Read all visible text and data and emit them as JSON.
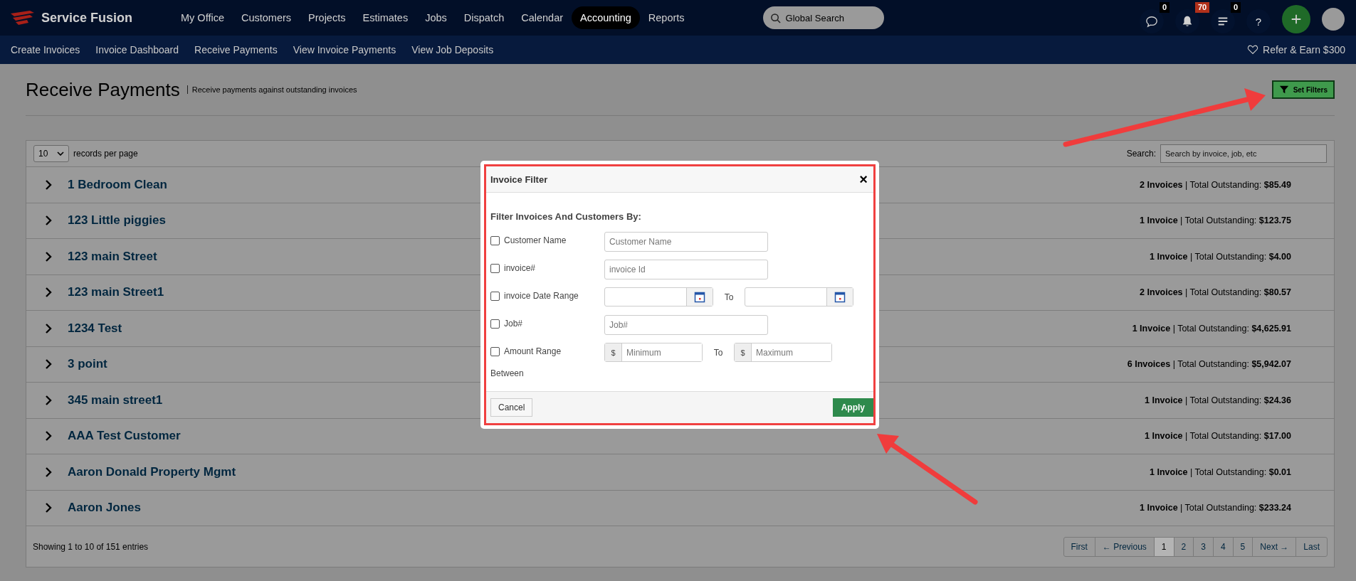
{
  "brand": {
    "name": "Service Fusion"
  },
  "nav": [
    {
      "label": "My Office",
      "selected": false
    },
    {
      "label": "Customers",
      "selected": false
    },
    {
      "label": "Projects",
      "selected": false
    },
    {
      "label": "Estimates",
      "selected": false
    },
    {
      "label": "Jobs",
      "selected": false
    },
    {
      "label": "Dispatch",
      "selected": false
    },
    {
      "label": "Calendar",
      "selected": false
    },
    {
      "label": "Accounting",
      "selected": true
    },
    {
      "label": "Reports",
      "selected": false
    }
  ],
  "global_search": {
    "placeholder": "Global Search"
  },
  "header_icons": [
    {
      "kind": "chat",
      "badge": "0",
      "alert": false
    },
    {
      "kind": "bell",
      "badge": "70",
      "alert": true
    },
    {
      "kind": "list",
      "badge": "0",
      "alert": false
    },
    {
      "kind": "help",
      "text": "?"
    },
    {
      "kind": "add"
    },
    {
      "kind": "avatar"
    }
  ],
  "subnav": [
    "Create Invoices",
    "Invoice Dashboard",
    "Receive Payments",
    "View Invoice Payments",
    "View Job Deposits"
  ],
  "refer": "Refer & Earn $300",
  "page": {
    "title": "Receive Payments",
    "subtitle": "Receive payments against outstanding invoices",
    "filter_button": "Set Filters"
  },
  "table": {
    "page_size": "10",
    "page_size_label": "records per page",
    "search_label": "Search:",
    "search_placeholder": "Search by invoice, job, etc",
    "rows": [
      {
        "name": "1 Bedroom Clean",
        "summary": "**2 Invoices** | Total Outstanding: **$85.49**"
      },
      {
        "name": "123 Little piggies",
        "summary": "**1 Invoice** | Total Outstanding: **$123.75**"
      },
      {
        "name": "123 main Street",
        "summary": "**1 Invoice** | Total Outstanding: **$4.00**"
      },
      {
        "name": "123 main Street1",
        "summary": "**2 Invoices** | Total Outstanding: **$80.57**"
      },
      {
        "name": "1234 Test",
        "summary": "**1 Invoice** | Total Outstanding: **$4,625.91**"
      },
      {
        "name": "3 point",
        "summary": "**6 Invoices** | Total Outstanding: **$5,942.07**"
      },
      {
        "name": "345 main street1",
        "summary": "**1 Invoice** | Total Outstanding: **$24.36**"
      },
      {
        "name": "AAA Test Customer",
        "summary": "**1 Invoice** | Total Outstanding: **$17.00**"
      },
      {
        "name": "Aaron Donald Property Mgmt",
        "summary": "**1 Invoice** | Total Outstanding: **$0.01**"
      },
      {
        "name": "Aaron Jones",
        "summary": "**1 Invoice** | Total Outstanding: **$233.24**"
      }
    ],
    "info": "Showing 1 to 10 of 151 entries",
    "pagination": [
      {
        "label": "First",
        "selected": false
      },
      {
        "label": "← Previous",
        "selected": false
      },
      {
        "label": "1",
        "selected": true
      },
      {
        "label": "2",
        "selected": false
      },
      {
        "label": "3",
        "selected": false
      },
      {
        "label": "4",
        "selected": false
      },
      {
        "label": "5",
        "selected": false
      },
      {
        "label": "Next →",
        "selected": false
      },
      {
        "label": "Last",
        "selected": false
      }
    ]
  },
  "dialog": {
    "title": "Invoice Filter",
    "close": "×",
    "heading": "Filter Invoices And Customers By:",
    "filters": [
      {
        "kind": "text",
        "label": "Customer Name",
        "checked": false,
        "placeholder": "Customer Name"
      },
      {
        "kind": "text",
        "label": "invoice#",
        "checked": false,
        "placeholder": "invoice Id"
      },
      {
        "kind": "date_range",
        "label": "invoice Date Range",
        "checked": false,
        "to": "To"
      },
      {
        "kind": "text",
        "label": "Job#",
        "checked": false,
        "placeholder": "Job#"
      },
      {
        "kind": "amount_range",
        "label": "Amount Range",
        "checked": false,
        "note": "Between",
        "prefix": "$",
        "min_placeholder": "Minimum",
        "to": "To",
        "max_placeholder": "Maximum"
      }
    ],
    "cancel": "Cancel",
    "apply": "Apply"
  }
}
